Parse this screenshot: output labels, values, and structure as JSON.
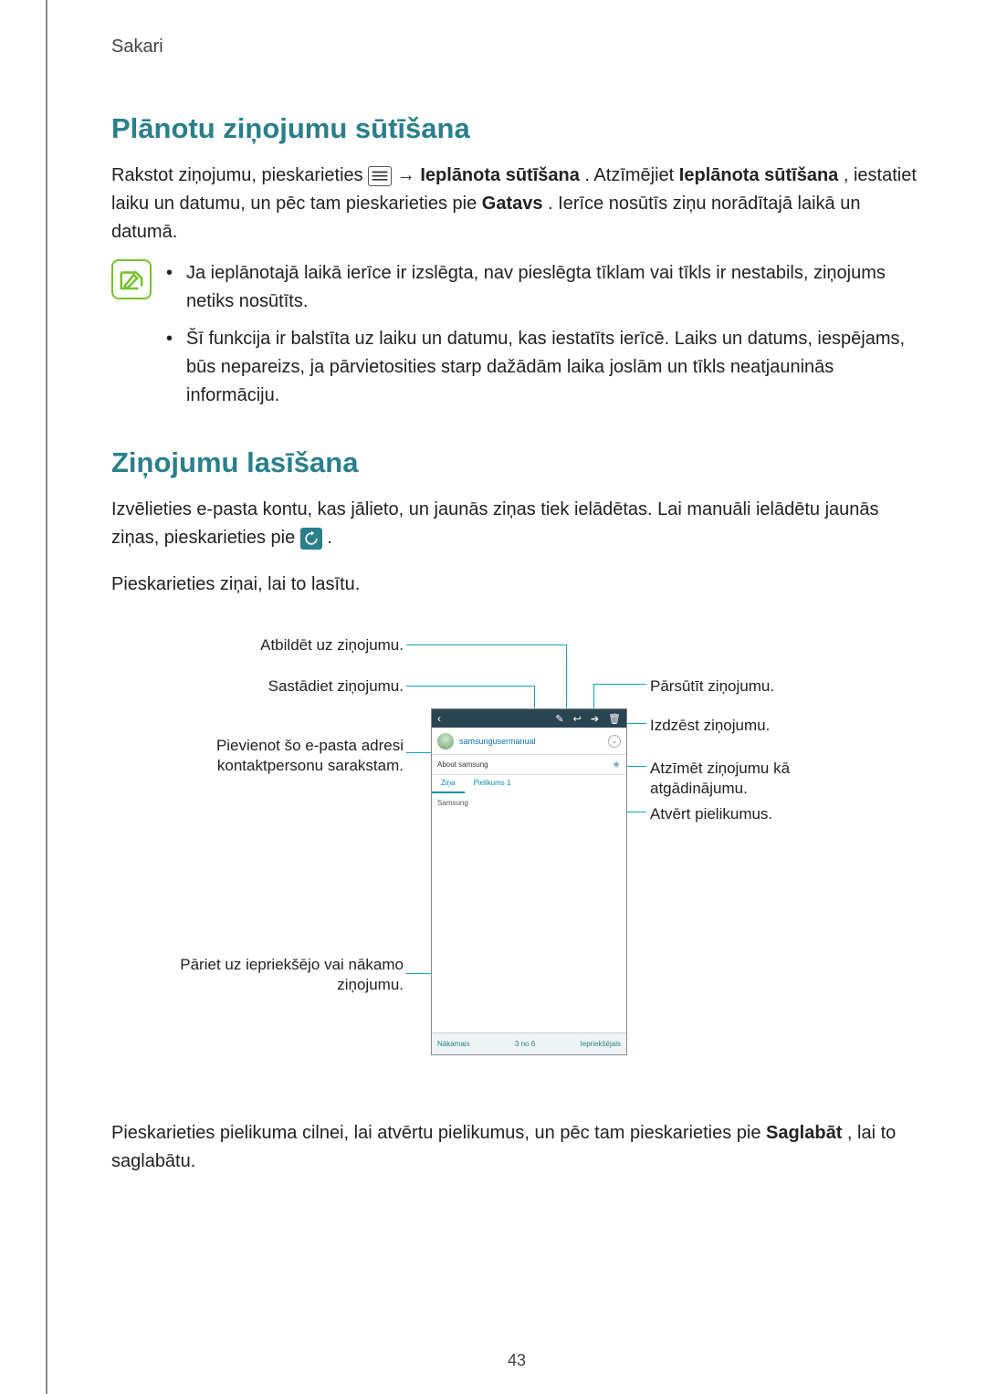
{
  "breadcrumb": "Sakari",
  "section1": {
    "heading": "Plānotu ziņojumu sūtīšana",
    "para_pre": "Rakstot ziņojumu, pieskarieties ",
    "arrow": " → ",
    "bold1": "Ieplānota sūtīšana",
    "mid": ". Atzīmējiet ",
    "bold2": "Ieplānota sūtīšana",
    "after": ", iestatiet laiku un datumu, un pēc tam pieskarieties pie ",
    "bold3": "Gatavs",
    "tail": ". Ierīce nosūtīs ziņu norādītajā laikā un datumā.",
    "note1": "Ja ieplānotajā laikā ierīce ir izslēgta, nav pieslēgta tīklam vai tīkls ir nestabils, ziņojums netiks nosūtīts.",
    "note2": "Šī funkcija ir balstīta uz laiku un datumu, kas iestatīts ierīcē. Laiks un datums, iespējams, būs nepareizs, ja pārvietosities starp dažādām laika joslām un tīkls neatjauninās informāciju."
  },
  "section2": {
    "heading": "Ziņojumu lasīšana",
    "para1_pre": "Izvēlieties e-pasta kontu, kas jālieto, un jaunās ziņas tiek ielādētas. Lai manuāli ielādētu jaunās ziņas, pieskarieties pie ",
    "para1_post": ".",
    "para2": "Pieskarieties ziņai, lai to lasītu."
  },
  "callouts": {
    "reply": "Atbildēt uz ziņojumu.",
    "compose": "Sastādiet ziņojumu.",
    "add_contact_l1": "Pievienot šo e-pasta adresi",
    "add_contact_l2": "kontaktpersonu sarakstam.",
    "prevnext_l1": "Pāriet uz iepriekšējo vai nākamo",
    "prevnext_l2": "ziņojumu.",
    "forward": "Pārsūtīt ziņojumu.",
    "delete": "Izdzēst ziņojumu.",
    "flag_l1": "Atzīmēt ziņojumu kā",
    "flag_l2": "atgādinājumu.",
    "open_attach": "Atvērt pielikumus."
  },
  "phone": {
    "sender": "samsungusermanual",
    "subject": "About samsung",
    "tab1": "Ziņa",
    "tab2": "Pielikums 1",
    "body": "Samsung",
    "nav_prev": "Nākamais",
    "nav_count": "3 no 6",
    "nav_next": "Iepriekšējais"
  },
  "section3": {
    "pre": "Pieskarieties pielikuma cilnei, lai atvērtu pielikumus, un pēc tam pieskarieties pie ",
    "bold": "Saglabāt",
    "post": ", lai to saglabātu."
  },
  "page_number": "43"
}
